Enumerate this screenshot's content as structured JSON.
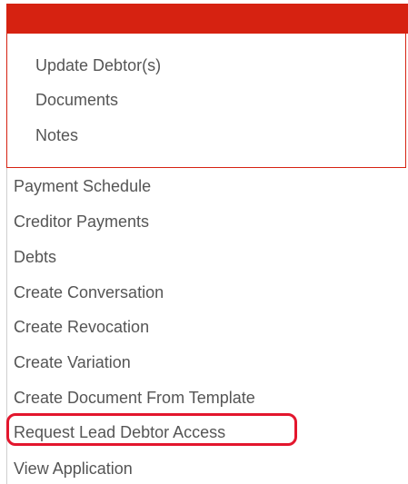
{
  "header": {
    "bar_color": "#d62211"
  },
  "submenu": {
    "items": [
      {
        "label": "Update Debtor(s)"
      },
      {
        "label": "Documents"
      },
      {
        "label": "Notes"
      }
    ]
  },
  "menu": {
    "items": [
      {
        "label": "Payment Schedule"
      },
      {
        "label": "Creditor Payments"
      },
      {
        "label": "Debts"
      },
      {
        "label": "Create Conversation"
      },
      {
        "label": "Create Revocation"
      },
      {
        "label": "Create Variation"
      },
      {
        "label": "Create Document From Template"
      },
      {
        "label": "Request Lead Debtor Access",
        "highlighted": true
      },
      {
        "label": "View Application"
      }
    ]
  },
  "highlight": {
    "color": "#e3162d",
    "target": "Request Lead Debtor Access"
  },
  "colors": {
    "text": "#555555",
    "accent": "#d62211"
  }
}
